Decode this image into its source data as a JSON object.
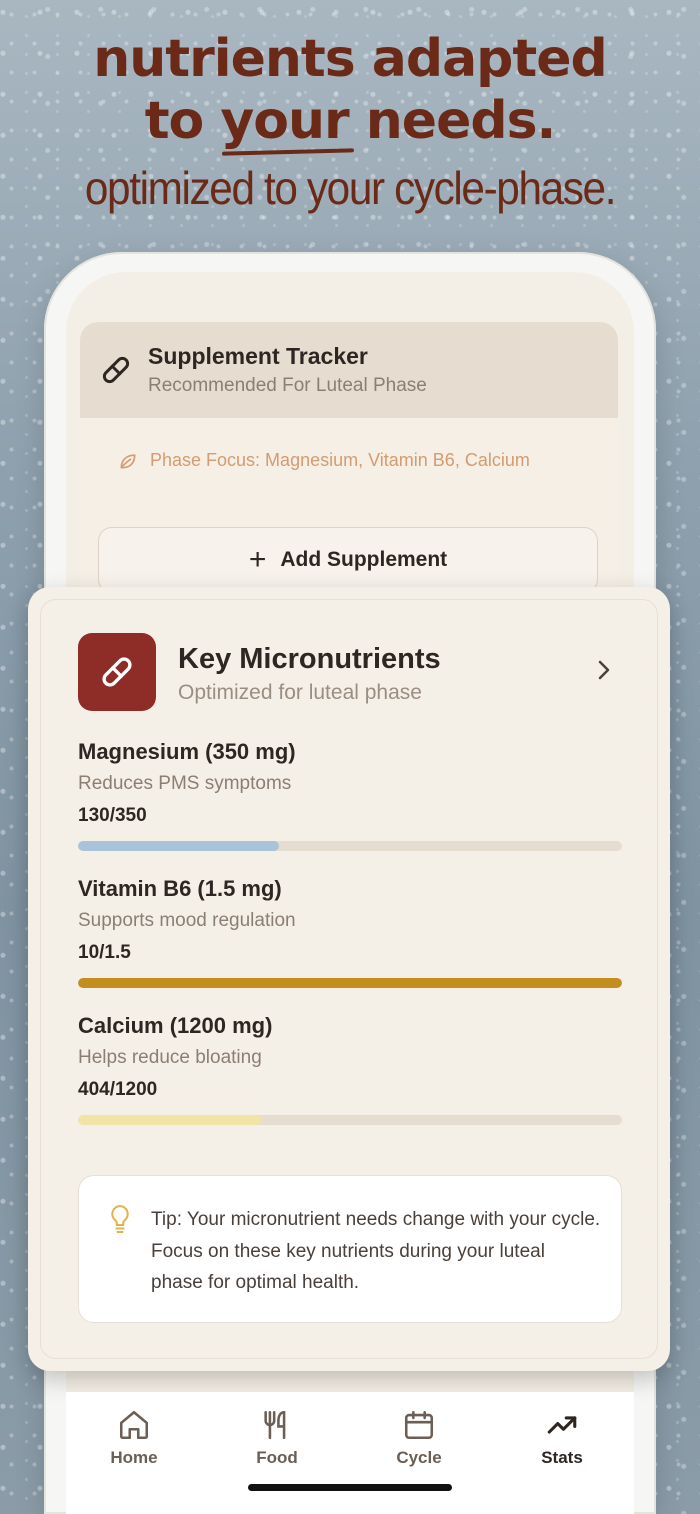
{
  "headline": {
    "line1": "nutrients adapted",
    "line2_pre": "to ",
    "line2_emph": "your",
    "line2_post": " needs.",
    "subline": "optimized to your cycle-phase."
  },
  "tracker": {
    "title": "Supplement Tracker",
    "subtitle": "Recommended For Luteal Phase",
    "icon": "pill-icon",
    "phase_focus": "Phase Focus: Magnesium, Vitamin B6, Calcium",
    "add_button": "Add Supplement"
  },
  "micronutrients": {
    "title": "Key Micronutrients",
    "subtitle": "Optimized for luteal phase",
    "items": [
      {
        "name": "Magnesium (350 mg)",
        "desc": "Reduces PMS symptoms",
        "value": "130/350",
        "progress": 0.37,
        "color": "#a9c3d8"
      },
      {
        "name": "Vitamin B6 (1.5 mg)",
        "desc": "Supports mood regulation",
        "value": "10/1.5",
        "progress": 1.0,
        "color": "#c48d1f"
      },
      {
        "name": "Calcium (1200 mg)",
        "desc": "Helps reduce bloating",
        "value": "404/1200",
        "progress": 0.337,
        "color": "#f2e3a6"
      }
    ],
    "tip": "Tip: Your micronutrient needs change with your cycle. Focus on these key nutrients during your luteal phase for optimal health."
  },
  "nav": {
    "items": [
      {
        "label": "Home",
        "icon": "home-icon"
      },
      {
        "label": "Food",
        "icon": "utensils-icon"
      },
      {
        "label": "Cycle",
        "icon": "calendar-icon"
      },
      {
        "label": "Stats",
        "icon": "trending-up-icon"
      }
    ],
    "active": "Stats"
  },
  "colors": {
    "brand": "#6a2a17",
    "accent": "#8e2c28",
    "focus_text": "#d39c72"
  }
}
